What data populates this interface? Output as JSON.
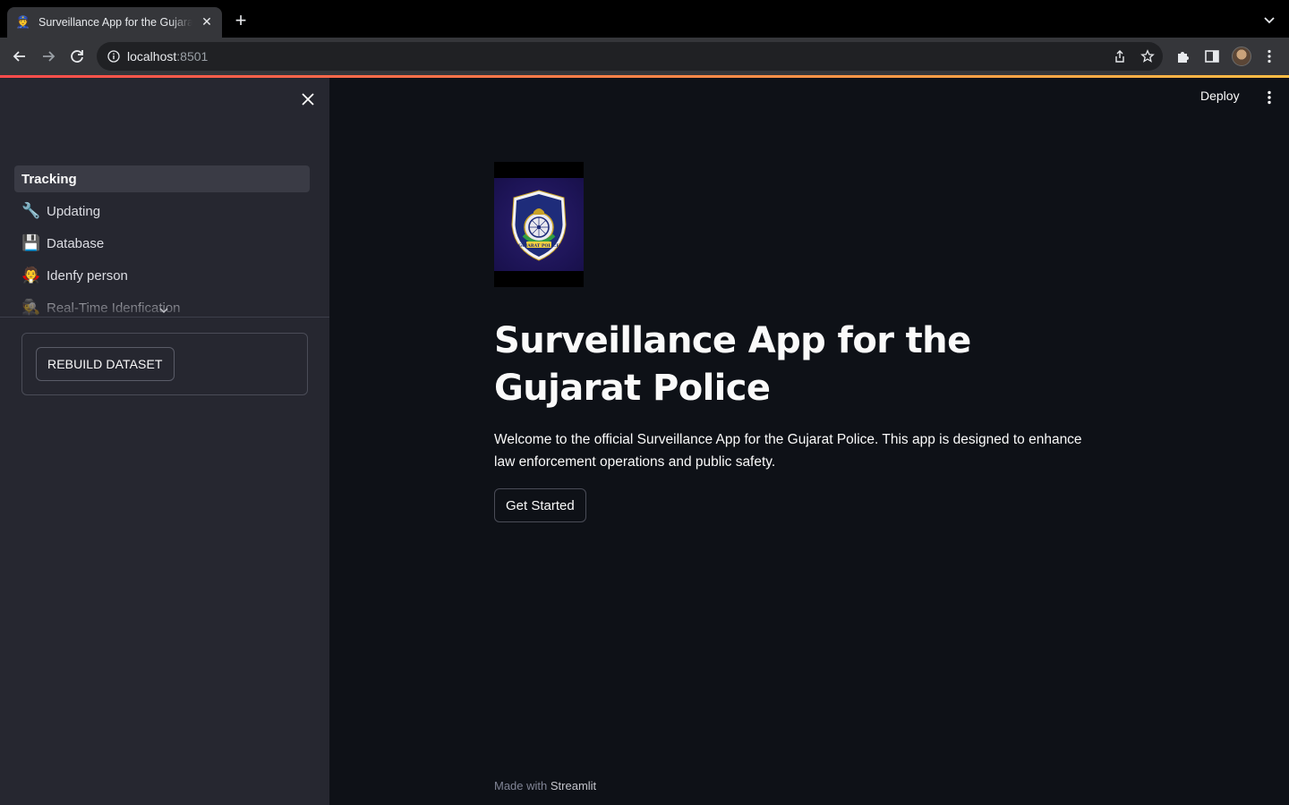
{
  "browser": {
    "tab_title": "Surveillance App for the Gujarat Police",
    "url_host": "localhost",
    "url_port": ":8501"
  },
  "sidebar": {
    "nav_items": [
      {
        "label": "Tracking",
        "icon": "none",
        "active": true
      },
      {
        "label": "Updating",
        "icon": "wrench-icon"
      },
      {
        "label": "Database",
        "icon": "floppy-disk-icon"
      },
      {
        "label": "Idenfy person",
        "icon": "vampire-face-icon"
      },
      {
        "label": "Real-Time Idenfication",
        "icon": "detective-icon"
      }
    ],
    "rebuild_button": "REBUILD DATASET"
  },
  "header": {
    "deploy_label": "Deploy"
  },
  "main": {
    "logo_text": "GUJARAT POLICE",
    "title": "Surveillance App for the Gujarat Police",
    "welcome": "Welcome to the official Surveillance App for the Gujarat Police. This app is designed to enhance law enforcement operations and public safety.",
    "get_started_label": "Get Started"
  },
  "footer": {
    "made_with": "Made with",
    "brand": "Streamlit"
  },
  "colors": {
    "background": "#0e1117",
    "sidebar": "#262730",
    "accent_start": "#ff4b4b",
    "accent_end": "#ffbd45",
    "text": "#fafafa"
  }
}
